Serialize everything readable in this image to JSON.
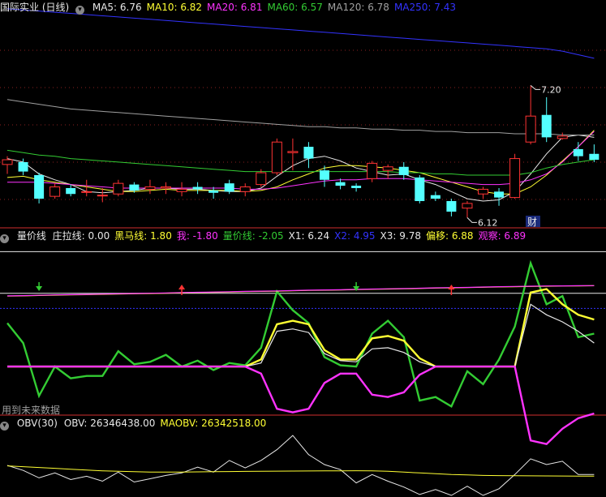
{
  "colors": {
    "white": "#e8e8e8",
    "yellow": "#ffff33",
    "magenta": "#ff33ff",
    "green": "#33cc33",
    "blue": "#3333ff",
    "red": "#ff3333",
    "cyan": "#54ffff",
    "grid": "#8a1f1f",
    "gray": "#a0a0a0"
  },
  "icons": {
    "pane_menu": "chevron-down-icon",
    "buy_marker": "red-up-arrow-icon",
    "sell_marker": "green-down-arrow-icon"
  },
  "panes": {
    "main": {
      "title": "国际实业 (日线)",
      "indicators": [
        {
          "label": "MA5: 6.76",
          "color": "#e8e8e8"
        },
        {
          "label": "MA10: 6.82",
          "color": "#ffff33"
        },
        {
          "label": "MA20: 6.81",
          "color": "#ff33ff"
        },
        {
          "label": "MA60: 6.57",
          "color": "#33cc33"
        },
        {
          "label": "MA120: 6.78",
          "color": "#a0a0a0"
        },
        {
          "label": "MA250: 7.43",
          "color": "#3333ff"
        }
      ],
      "annotations": {
        "high": "7.20",
        "low": "6.12",
        "badge": "财"
      }
    },
    "volprice": {
      "title": "量价线",
      "indicators": [
        {
          "label": "庄拉线: 0.00",
          "color": "#e8e8e8"
        },
        {
          "label": "黑马线: 1.80",
          "color": "#ffff33"
        },
        {
          "label": "我: -1.80",
          "color": "#ff33ff"
        },
        {
          "label": "量价线: -2.05",
          "color": "#33cc33"
        },
        {
          "label": "X1: 6.24",
          "color": "#e8e8e8"
        },
        {
          "label": "X2: 4.95",
          "color": "#3333ff"
        },
        {
          "label": "X3: 9.78",
          "color": "#e8e8e8"
        },
        {
          "label": "偏移: 6.88",
          "color": "#ffff33"
        },
        {
          "label": "观察: 6.89",
          "color": "#ff33ff"
        }
      ],
      "note": "用到未来数据"
    },
    "obv": {
      "title": "OBV(30)",
      "indicators": [
        {
          "label": "OBV: 26346438.00",
          "color": "#e8e8e8"
        },
        {
          "label": "MAOBV: 26342518.00",
          "color": "#ffff33"
        }
      ]
    }
  },
  "chart_data": [
    {
      "type": "candlestick",
      "pane": "main",
      "ylim": [
        6.0,
        7.8
      ],
      "candles": [
        {
          "o": 6.53,
          "h": 6.6,
          "l": 6.45,
          "c": 6.57
        },
        {
          "o": 6.55,
          "h": 6.58,
          "l": 6.44,
          "c": 6.47
        },
        {
          "o": 6.44,
          "h": 6.46,
          "l": 6.2,
          "c": 6.24
        },
        {
          "o": 6.26,
          "h": 6.37,
          "l": 6.24,
          "c": 6.34
        },
        {
          "o": 6.33,
          "h": 6.36,
          "l": 6.26,
          "c": 6.28
        },
        {
          "o": 6.3,
          "h": 6.4,
          "l": 6.26,
          "c": 6.3
        },
        {
          "o": 6.27,
          "h": 6.33,
          "l": 6.21,
          "c": 6.27
        },
        {
          "o": 6.28,
          "h": 6.4,
          "l": 6.26,
          "c": 6.37
        },
        {
          "o": 6.36,
          "h": 6.38,
          "l": 6.29,
          "c": 6.31
        },
        {
          "o": 6.32,
          "h": 6.4,
          "l": 6.28,
          "c": 6.34
        },
        {
          "o": 6.33,
          "h": 6.38,
          "l": 6.28,
          "c": 6.34
        },
        {
          "o": 6.3,
          "h": 6.38,
          "l": 6.26,
          "c": 6.32
        },
        {
          "o": 6.34,
          "h": 6.38,
          "l": 6.28,
          "c": 6.32
        },
        {
          "o": 6.31,
          "h": 6.34,
          "l": 6.24,
          "c": 6.29
        },
        {
          "o": 6.37,
          "h": 6.4,
          "l": 6.28,
          "c": 6.3
        },
        {
          "o": 6.3,
          "h": 6.37,
          "l": 6.26,
          "c": 6.34
        },
        {
          "o": 6.36,
          "h": 6.49,
          "l": 6.34,
          "c": 6.46
        },
        {
          "o": 6.46,
          "h": 6.75,
          "l": 6.44,
          "c": 6.72
        },
        {
          "o": 6.63,
          "h": 6.75,
          "l": 6.48,
          "c": 6.64
        },
        {
          "o": 6.68,
          "h": 6.72,
          "l": 6.5,
          "c": 6.58
        },
        {
          "o": 6.48,
          "h": 6.52,
          "l": 6.34,
          "c": 6.4
        },
        {
          "o": 6.38,
          "h": 6.41,
          "l": 6.32,
          "c": 6.35
        },
        {
          "o": 6.35,
          "h": 6.37,
          "l": 6.3,
          "c": 6.33
        },
        {
          "o": 6.41,
          "h": 6.56,
          "l": 6.38,
          "c": 6.54
        },
        {
          "o": 6.48,
          "h": 6.53,
          "l": 6.41,
          "c": 6.51
        },
        {
          "o": 6.51,
          "h": 6.55,
          "l": 6.4,
          "c": 6.44
        },
        {
          "o": 6.42,
          "h": 6.44,
          "l": 6.2,
          "c": 6.22
        },
        {
          "o": 6.27,
          "h": 6.3,
          "l": 6.22,
          "c": 6.24
        },
        {
          "o": 6.22,
          "h": 6.24,
          "l": 6.09,
          "c": 6.13
        },
        {
          "o": 6.16,
          "h": 6.22,
          "l": 6.08,
          "c": 6.2
        },
        {
          "o": 6.28,
          "h": 6.34,
          "l": 6.24,
          "c": 6.32
        },
        {
          "o": 6.3,
          "h": 6.33,
          "l": 6.18,
          "c": 6.25
        },
        {
          "o": 6.25,
          "h": 6.62,
          "l": 6.24,
          "c": 6.58
        },
        {
          "o": 6.72,
          "h": 7.2,
          "l": 6.7,
          "c": 6.94
        },
        {
          "o": 6.95,
          "h": 7.1,
          "l": 6.72,
          "c": 6.76
        },
        {
          "o": 6.75,
          "h": 6.8,
          "l": 6.74,
          "c": 6.77
        },
        {
          "o": 6.66,
          "h": 6.72,
          "l": 6.56,
          "c": 6.6
        },
        {
          "o": 6.62,
          "h": 6.7,
          "l": 6.55,
          "c": 6.57
        }
      ],
      "series": [
        {
          "name": "MA5",
          "color": "#e8e8e8",
          "values": [
            6.58,
            6.55,
            6.45,
            6.4,
            6.36,
            6.3,
            6.29,
            6.3,
            6.31,
            6.33,
            6.33,
            6.32,
            6.32,
            6.31,
            6.3,
            6.3,
            6.33,
            6.43,
            6.52,
            6.58,
            6.6,
            6.56,
            6.5,
            6.47,
            6.44,
            6.45,
            6.4,
            6.36,
            6.3,
            6.24,
            6.22,
            6.23,
            6.3,
            6.45,
            6.62,
            6.76,
            6.78,
            6.76
          ]
        },
        {
          "name": "MA10",
          "color": "#ffff33",
          "values": [
            6.42,
            6.43,
            6.4,
            6.38,
            6.36,
            6.34,
            6.32,
            6.3,
            6.3,
            6.31,
            6.32,
            6.31,
            6.31,
            6.31,
            6.31,
            6.3,
            6.31,
            6.34,
            6.4,
            6.45,
            6.5,
            6.52,
            6.52,
            6.51,
            6.5,
            6.48,
            6.46,
            6.42,
            6.38,
            6.34,
            6.3,
            6.28,
            6.28,
            6.34,
            6.44,
            6.56,
            6.68,
            6.82
          ]
        },
        {
          "name": "MA20",
          "color": "#ff33ff",
          "values": [
            6.38,
            6.38,
            6.38,
            6.37,
            6.36,
            6.35,
            6.34,
            6.33,
            6.33,
            6.33,
            6.33,
            6.33,
            6.33,
            6.33,
            6.33,
            6.32,
            6.32,
            6.33,
            6.35,
            6.37,
            6.39,
            6.4,
            6.4,
            6.41,
            6.41,
            6.41,
            6.4,
            6.39,
            6.38,
            6.37,
            6.36,
            6.36,
            6.37,
            6.4,
            6.45,
            6.55,
            6.68,
            6.81
          ]
        },
        {
          "name": "MA60",
          "color": "#33cc33",
          "values": [
            6.65,
            6.63,
            6.61,
            6.6,
            6.58,
            6.57,
            6.56,
            6.55,
            6.54,
            6.53,
            6.52,
            6.51,
            6.5,
            6.49,
            6.48,
            6.47,
            6.47,
            6.47,
            6.47,
            6.47,
            6.47,
            6.47,
            6.47,
            6.47,
            6.47,
            6.46,
            6.46,
            6.45,
            6.45,
            6.44,
            6.44,
            6.44,
            6.44,
            6.46,
            6.5,
            6.53,
            6.55,
            6.57
          ]
        },
        {
          "name": "MA120",
          "color": "#a0a0a0",
          "values": [
            7.08,
            7.06,
            7.04,
            7.02,
            7.0,
            6.99,
            6.98,
            6.97,
            6.96,
            6.95,
            6.94,
            6.93,
            6.92,
            6.91,
            6.9,
            6.89,
            6.88,
            6.87,
            6.86,
            6.85,
            6.85,
            6.84,
            6.84,
            6.83,
            6.83,
            6.82,
            6.82,
            6.81,
            6.81,
            6.8,
            6.8,
            6.8,
            6.79,
            6.79,
            6.79,
            6.78,
            6.78,
            6.78
          ]
        },
        {
          "name": "MA250",
          "color": "#3333ff",
          "values": [
            7.85,
            7.84,
            7.83,
            7.82,
            7.81,
            7.8,
            7.79,
            7.78,
            7.77,
            7.76,
            7.75,
            7.74,
            7.73,
            7.72,
            7.71,
            7.7,
            7.69,
            7.68,
            7.67,
            7.66,
            7.65,
            7.64,
            7.63,
            7.62,
            7.61,
            7.6,
            7.59,
            7.58,
            7.57,
            7.56,
            7.55,
            7.54,
            7.53,
            7.52,
            7.51,
            7.49,
            7.46,
            7.43
          ]
        }
      ]
    },
    {
      "type": "line",
      "pane": "volprice",
      "ylim": [
        -4,
        10.5
      ],
      "hlines": [
        {
          "name": "X1",
          "value": 6.24,
          "color": "#e8e8e8"
        },
        {
          "name": "X2",
          "value": 4.95,
          "color": "#3333ff",
          "dashed": true
        },
        {
          "name": "X3",
          "value": 9.78,
          "color": "#e8e8e8"
        }
      ],
      "series": [
        {
          "name": "量价线",
          "color": "#33cc33",
          "values": [
            3.7,
            2.0,
            -2.5,
            0,
            -1,
            -0.8,
            -0.8,
            1.3,
            0.2,
            0.4,
            1.0,
            0,
            0.5,
            -0.3,
            0.3,
            0.1,
            1.6,
            6.4,
            4.8,
            3.7,
            0.8,
            0.1,
            0,
            2.8,
            3.9,
            2.5,
            -2.9,
            -2.6,
            -3.4,
            -0.4,
            -1.5,
            0.6,
            3.4,
            8.8,
            5.3,
            6.0,
            2.5,
            2.8
          ]
        },
        {
          "name": "黑马线",
          "color": "#ffff33",
          "values": [
            0,
            0,
            0,
            0,
            0,
            0,
            0,
            0,
            0,
            0,
            0,
            0,
            0,
            0,
            0,
            0,
            0.6,
            3.6,
            3.9,
            3.6,
            1.4,
            0.6,
            0.6,
            2.4,
            2.6,
            2.2,
            0.7,
            0,
            0,
            0,
            0,
            0,
            0,
            6.3,
            6.6,
            5.3,
            4.4,
            4.0
          ]
        },
        {
          "name": "庄拉线",
          "color": "#e8e8e8",
          "values": [
            0,
            0,
            0,
            0,
            0,
            0,
            0,
            0,
            0,
            0,
            0,
            0,
            0,
            0,
            0,
            0,
            0.3,
            3.0,
            3.2,
            2.9,
            1.1,
            0.5,
            0.4,
            1.5,
            1.6,
            1.2,
            0.4,
            0,
            0,
            0,
            0,
            0,
            0,
            5.3,
            4.4,
            3.8,
            3.0,
            2.0
          ]
        },
        {
          "name": "我",
          "color": "#ff33ff",
          "values": [
            0,
            0,
            0,
            0,
            0,
            0,
            0,
            0,
            0,
            0,
            0,
            0,
            0,
            0,
            0,
            0,
            -0.6,
            -3.6,
            -3.9,
            -3.6,
            -1.4,
            -0.6,
            -0.6,
            -2.4,
            -2.6,
            -2.2,
            -0.7,
            0,
            0,
            0,
            0,
            0,
            0,
            -6.3,
            -6.6,
            -5.3,
            -4.4,
            -4.0
          ]
        },
        {
          "name": "偏移",
          "color": "#ffff33",
          "values": [
            6.0,
            6.02,
            6.05,
            6.08,
            6.1,
            6.12,
            6.15,
            6.18,
            6.2,
            6.22,
            6.25,
            6.28,
            6.3,
            6.32,
            6.35,
            6.38,
            6.4,
            6.42,
            6.45,
            6.48,
            6.5,
            6.52,
            6.55,
            6.58,
            6.6,
            6.62,
            6.65,
            6.68,
            6.7,
            6.72,
            6.75,
            6.78,
            6.8,
            6.82,
            6.84,
            6.86,
            6.87,
            6.88
          ]
        },
        {
          "name": "观察",
          "color": "#ff33ff",
          "values": [
            6.02,
            6.04,
            6.07,
            6.1,
            6.12,
            6.14,
            6.17,
            6.2,
            6.22,
            6.24,
            6.27,
            6.3,
            6.32,
            6.34,
            6.37,
            6.4,
            6.42,
            6.44,
            6.47,
            6.5,
            6.52,
            6.54,
            6.57,
            6.6,
            6.62,
            6.64,
            6.67,
            6.7,
            6.72,
            6.74,
            6.77,
            6.8,
            6.82,
            6.84,
            6.86,
            6.87,
            6.88,
            6.89
          ]
        }
      ],
      "markers": [
        {
          "index": 2,
          "type": "sell"
        },
        {
          "index": 11,
          "type": "buy"
        },
        {
          "index": 22,
          "type": "sell"
        },
        {
          "index": 28,
          "type": "buy"
        }
      ]
    },
    {
      "type": "line",
      "pane": "obv",
      "ylim": [
        26340000,
        26348000
      ],
      "series": [
        {
          "name": "OBV",
          "color": "#e8e8e8",
          "values": [
            26343800,
            26343200,
            26342300,
            26342900,
            26342100,
            26342500,
            26341900,
            26343000,
            26341800,
            26342200,
            26342600,
            26342900,
            26343600,
            26343000,
            26344400,
            26343500,
            26344400,
            26345700,
            26347400,
            26345100,
            26343900,
            26343300,
            26341700,
            26342700,
            26341900,
            26341200,
            26340300,
            26340900,
            26340200,
            26341300,
            26340200,
            26341000,
            26342700,
            26344600,
            26343900,
            26344300,
            26342700,
            26342700
          ]
        },
        {
          "name": "MAOBV",
          "color": "#ffff33",
          "values": [
            26343750,
            26343650,
            26343550,
            26343450,
            26343350,
            26343250,
            26343150,
            26343100,
            26343050,
            26343000,
            26343000,
            26343000,
            26343020,
            26343040,
            26343060,
            26343080,
            26343100,
            26343110,
            26343120,
            26343130,
            26343140,
            26343150,
            26343160,
            26343150,
            26343100,
            26343000,
            26342900,
            26342800,
            26342700,
            26342650,
            26342600,
            26342580,
            26342560,
            26342550,
            26342540,
            26342530,
            26342520,
            26342518
          ]
        }
      ]
    }
  ]
}
